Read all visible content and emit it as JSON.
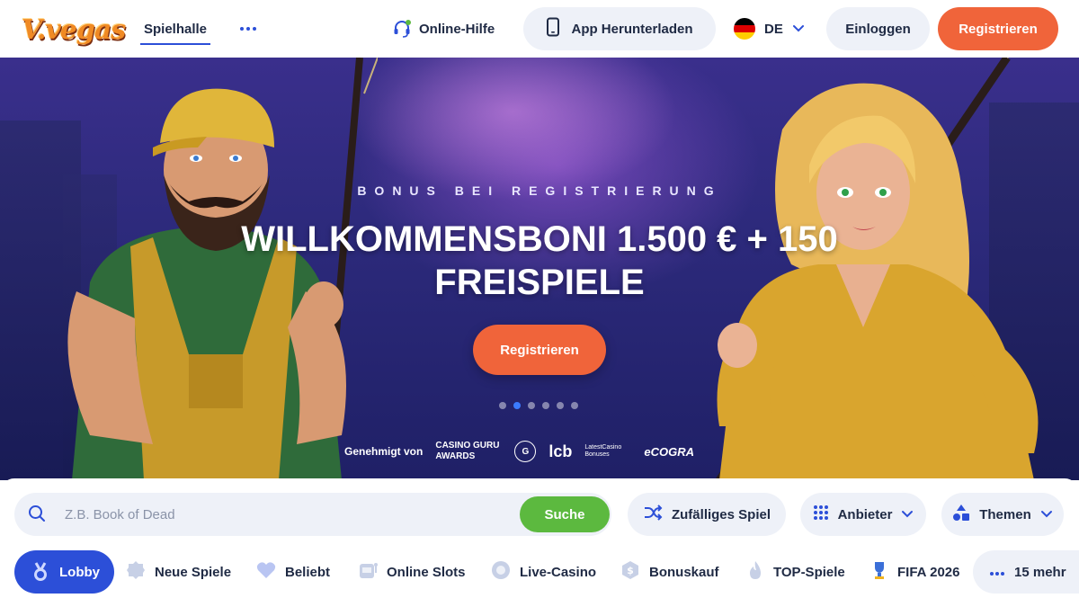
{
  "header": {
    "logo_text": "V.vegas",
    "nav_tab": "Spielhalle",
    "help_label": "Online-Hilfe",
    "app_label": "App Herunterladen",
    "language": "DE",
    "login_label": "Einloggen",
    "register_label": "Registrieren"
  },
  "hero": {
    "eyebrow": "BONUS BEI REGISTRIERUNG",
    "headline": "WILLKOMMENSBONI 1.500 € + 150 FREISPIELE",
    "cta_label": "Registrieren",
    "slide_count": 6,
    "active_slide": 2,
    "approved_label": "Genehmigt von",
    "badges": {
      "casino_guru": "CASINO GURU AWARDS",
      "casino_guru_mark": "G",
      "lcb": "lcb",
      "latest_casino": "LatestCasino Bonuses",
      "ecogra": "eCOGRA"
    }
  },
  "search": {
    "placeholder": "Z.B. Book of Dead",
    "button_label": "Suche"
  },
  "filters": {
    "random": "Zufälliges Spiel",
    "provider": "Anbieter",
    "themes": "Themen"
  },
  "categories": [
    {
      "label": "Lobby",
      "icon": "medal-icon",
      "active": true
    },
    {
      "label": "Neue Spiele",
      "icon": "new-badge-icon",
      "active": false
    },
    {
      "label": "Beliebt",
      "icon": "heart-icon",
      "active": false
    },
    {
      "label": "Online Slots",
      "icon": "slot-machine-icon",
      "active": false
    },
    {
      "label": "Live-Casino",
      "icon": "live-dot-icon",
      "active": false
    },
    {
      "label": "Bonuskauf",
      "icon": "dollar-coin-icon",
      "active": false
    },
    {
      "label": "TOP-Spiele",
      "icon": "flame-icon",
      "active": false
    },
    {
      "label": "FIFA 2026",
      "icon": "trophy-icon",
      "active": false
    }
  ],
  "more_categories": "15 mehr",
  "colors": {
    "accent_blue": "#2c4fd8",
    "cta_orange": "#f0643a",
    "search_green": "#5cb93f",
    "pill_bg": "#eef1f8",
    "text_dark": "#1f2a44"
  }
}
